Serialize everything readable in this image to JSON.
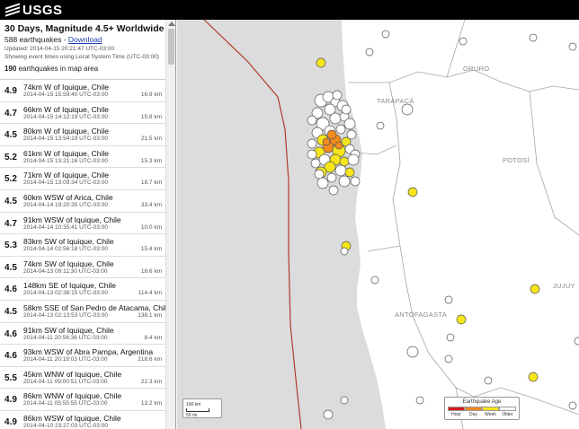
{
  "header": {
    "logo_text": "USGS"
  },
  "feed": {
    "title": "30 Days, Magnitude 4.5+ Worldwide",
    "count_text": "588 earthquakes - ",
    "download_label": "Download",
    "updated": "Updated: 2014-04-15 20:21:47 UTC-03:00",
    "time_note": "Showing event times using Local System Time (UTC-03:00)",
    "map_area_count": "190",
    "map_area_text": " earthquakes in map area"
  },
  "earthquakes": [
    {
      "mag": "4.9",
      "place": "74km W of Iquique, Chile",
      "time": "2014-04-15 15:59:40 UTC-03:00",
      "depth": "16.9 km"
    },
    {
      "mag": "4.7",
      "place": "66km W of Iquique, Chile",
      "time": "2014-04-15 14:12:19 UTC-03:00",
      "depth": "15.8 km"
    },
    {
      "mag": "4.5",
      "place": "80km W of Iquique, Chile",
      "time": "2014-04-15 13:54:19 UTC-03:00",
      "depth": "21.5 km"
    },
    {
      "mag": "5.2",
      "place": "61km W of Iquique, Chile",
      "time": "2014-04-15 13:21:16 UTC-03:00",
      "depth": "15.3 km"
    },
    {
      "mag": "5.2",
      "place": "71km W of Iquique, Chile",
      "time": "2014-04-15 13:09:34 UTC-03:00",
      "depth": "18.7 km"
    },
    {
      "mag": "4.5",
      "place": "60km WSW of Arica, Chile",
      "time": "2014-04-14 19:20:35 UTC-03:00",
      "depth": "33.4 km"
    },
    {
      "mag": "4.7",
      "place": "91km WSW of Iquique, Chile",
      "time": "2014-04-14 10:35:41 UTC-03:00",
      "depth": "10.0 km"
    },
    {
      "mag": "5.3",
      "place": "83km SW of Iquique, Chile",
      "time": "2014-04-14 02:56:18 UTC-03:00",
      "depth": "15.4 km"
    },
    {
      "mag": "4.5",
      "place": "74km SW of Iquique, Chile",
      "time": "2014-04-13 09:11:30 UTC-03:00",
      "depth": "18.6 km"
    },
    {
      "mag": "4.6",
      "place": "148km SE of Iquique, Chile",
      "time": "2014-04-13 02:38:15 UTC-03:00",
      "depth": "114.4 km"
    },
    {
      "mag": "4.5",
      "place": "58km SSE of San Pedro de Atacama, Chile",
      "time": "2014-04-13 02:13:53 UTC-03:00",
      "depth": "138.1 km"
    },
    {
      "mag": "4.6",
      "place": "91km SW of Iquique, Chile",
      "time": "2014-04-11 20:56:36 UTC-03:00",
      "depth": "8.4 km"
    },
    {
      "mag": "4.6",
      "place": "93km WSW of Abra Pampa, Argentina",
      "time": "2014-04-11 20:19:03 UTC-03:00",
      "depth": "218.6 km"
    },
    {
      "mag": "5.5",
      "place": "45km WNW of Iquique, Chile",
      "time": "2014-04-11 09:00:51 UTC-03:00",
      "depth": "22.3 km"
    },
    {
      "mag": "4.9",
      "place": "86km WNW of Iquique, Chile",
      "time": "2014-04-11 05:55:55 UTC-03:00",
      "depth": "13.2 km"
    },
    {
      "mag": "4.9",
      "place": "86km WSW of Iquique, Chile",
      "time": "2014-04-10 23:27:03 UTC-03:00",
      "depth": ""
    }
  ],
  "map": {
    "labels": {
      "oruro": "ORURO",
      "tarapaca": "TARAPACÁ",
      "potosi": "POTOSÍ",
      "antofagasta": "ANTOFAGASTA",
      "jujuy": "JUJUY"
    },
    "scale": {
      "top": "100 km",
      "bottom": "50 mi"
    },
    "legend": {
      "title": "Earthquake Age",
      "labels": [
        "Hour",
        "Day",
        "Week",
        "Older"
      ],
      "colors": [
        "#d7191c",
        "#f28a1c",
        "#f5e51a",
        "#ffffff"
      ]
    },
    "colors": {
      "ocean": "#dcdcdc",
      "land": "#ffffff",
      "plate_boundary": "#b03a2e",
      "border": "#a5a5a5"
    }
  }
}
